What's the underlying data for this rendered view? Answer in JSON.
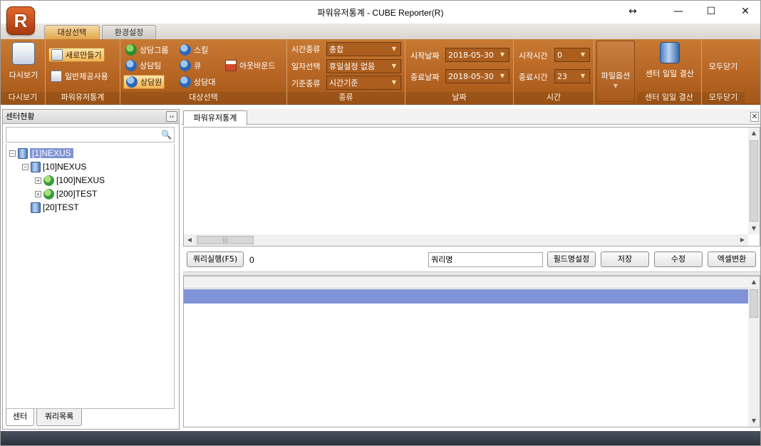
{
  "window": {
    "title": "파워유저통계 - CUBE Reporter(R)",
    "logo_letter": "R",
    "move_glyph": "↔",
    "minimize_glyph": "—",
    "maximize_glyph": "☐",
    "close_glyph": "✕"
  },
  "ribbon_tabs": [
    {
      "label": "대상선택",
      "active": true
    },
    {
      "label": "환경설정",
      "active": false
    }
  ],
  "ribbon": {
    "view": {
      "button": "다시보기",
      "group": "다시보기"
    },
    "stats": {
      "new": "새로만들기",
      "general": "일반제공사용",
      "group": "파워유저통계"
    },
    "target": {
      "items": [
        "상담그룹",
        "상담팀",
        "상담원",
        "스킬",
        "큐",
        "상담대",
        "아웃바운드"
      ],
      "selected": "상담원",
      "group": "대상선택"
    },
    "kind": {
      "time_kind_label": "시간종류",
      "time_kind_value": "총합",
      "date_select_label": "일자선택",
      "date_select_value": "휴일설정 없음",
      "base_kind_label": "기준종류",
      "base_kind_value": "시간기준",
      "group": "종류"
    },
    "date": {
      "start_label": "시작날짜",
      "start_value": "2018-05-30",
      "end_label": "종료날짜",
      "end_value": "2018-05-30",
      "group": "날짜"
    },
    "time": {
      "start_label": "시작시간",
      "start_value": "0",
      "end_label": "종료시간",
      "end_value": "23",
      "group": "시간"
    },
    "file_options": {
      "label": "파일옵션",
      "arrow": "▼"
    },
    "settle": {
      "button": "센터 일일 결산",
      "group": "센터 일일 결산"
    },
    "close_all": {
      "button": "모두닫기",
      "group": "모두닫기"
    }
  },
  "left_panel": {
    "title": "센터현황",
    "collapse_glyph": "‹‹",
    "search_placeholder": "",
    "search_icon_glyph": "🔍",
    "tree": [
      {
        "label": "[1]NEXUS",
        "expander": "−",
        "selected": true
      },
      {
        "label": "[10]NEXUS",
        "expander": "−",
        "selected": false
      },
      {
        "label": "[100]NEXUS",
        "expander": "+",
        "selected": false
      },
      {
        "label": "[200]TEST",
        "expander": "+",
        "selected": false
      },
      {
        "label": "[20]TEST",
        "expander": "",
        "selected": false
      }
    ],
    "bottom_tabs": [
      "센터",
      "쿼리목록"
    ]
  },
  "document": {
    "tab": "파워유저통계",
    "close_glyph": "✕",
    "scroll_up": "▲",
    "scroll_down": "▼",
    "scroll_left": "◀",
    "scroll_right": "▶",
    "grip": "|||",
    "toolbar": {
      "run_query": "쿼리실행(F5)",
      "count": "0",
      "query_name_value": "쿼리명",
      "field_name": "필드명설정",
      "save": "저장",
      "edit": "수정",
      "excel": "엑셀변환"
    }
  },
  "colors": {
    "ribbon": "#b76523",
    "selection": "#7f93d6",
    "status_bar": "#2b313b"
  }
}
